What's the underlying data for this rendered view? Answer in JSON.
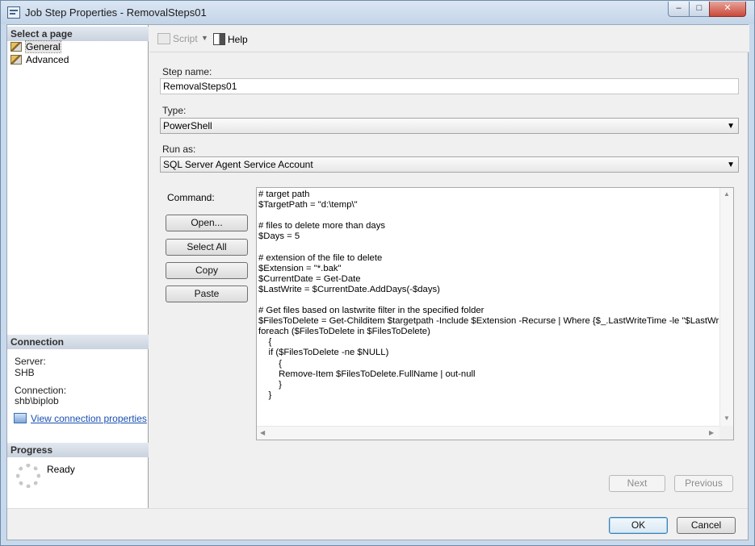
{
  "window": {
    "title": "Job Step Properties - RemovalSteps01",
    "minimize_glyph": "–",
    "maximize_glyph": "□",
    "close_glyph": "✕"
  },
  "left_panel": {
    "select_page_header": "Select a page",
    "pages": [
      {
        "label": "General",
        "icon": "page-icon",
        "selected": true
      },
      {
        "label": "Advanced",
        "icon": "page-icon",
        "selected": false
      }
    ],
    "connection_header": "Connection",
    "server_label": "Server:",
    "server_value": "SHB",
    "connection_label": "Connection:",
    "connection_value": "shb\\biplob",
    "view_connection_link": "View connection properties",
    "progress_header": "Progress",
    "progress_status": "Ready"
  },
  "toolbar": {
    "script_label": "Script",
    "script_dropdown_glyph": "▼",
    "help_label": "Help"
  },
  "form": {
    "step_name_label": "Step name:",
    "step_name_value": "RemovalSteps01",
    "type_label": "Type:",
    "type_value": "PowerShell",
    "run_as_label": "Run as:",
    "run_as_value": "SQL Server Agent Service Account",
    "command_label": "Command:",
    "dropdown_glyph": "▼",
    "buttons": {
      "open": "Open...",
      "select_all": "Select All",
      "copy": "Copy",
      "paste": "Paste"
    },
    "command_text": "# target path\n$TargetPath = \"d:\\temp\\\"\n\n# files to delete more than days\n$Days = 5\n\n# extension of the file to delete\n$Extension = \"*.bak\"\n$CurrentDate = Get-Date\n$LastWrite = $CurrentDate.AddDays(-$days)\n\n# Get files based on lastwrite filter in the specified folder\n$FilesToDelete = Get-Childitem $targetpath -Include $Extension -Recurse | Where {$_.LastWriteTime -le \"$LastWrite\"}\nforeach ($FilesToDelete in $FilesToDelete)\n    {\n    if ($FilesToDelete -ne $NULL)\n        {\n        Remove-Item $FilesToDelete.FullName | out-null\n        }\n    }",
    "scroll_up_glyph": "▲",
    "scroll_down_glyph": "▼",
    "scroll_left_glyph": "◀",
    "scroll_right_glyph": "▶",
    "next_label": "Next",
    "previous_label": "Previous"
  },
  "footer": {
    "ok_label": "OK",
    "cancel_label": "Cancel"
  }
}
